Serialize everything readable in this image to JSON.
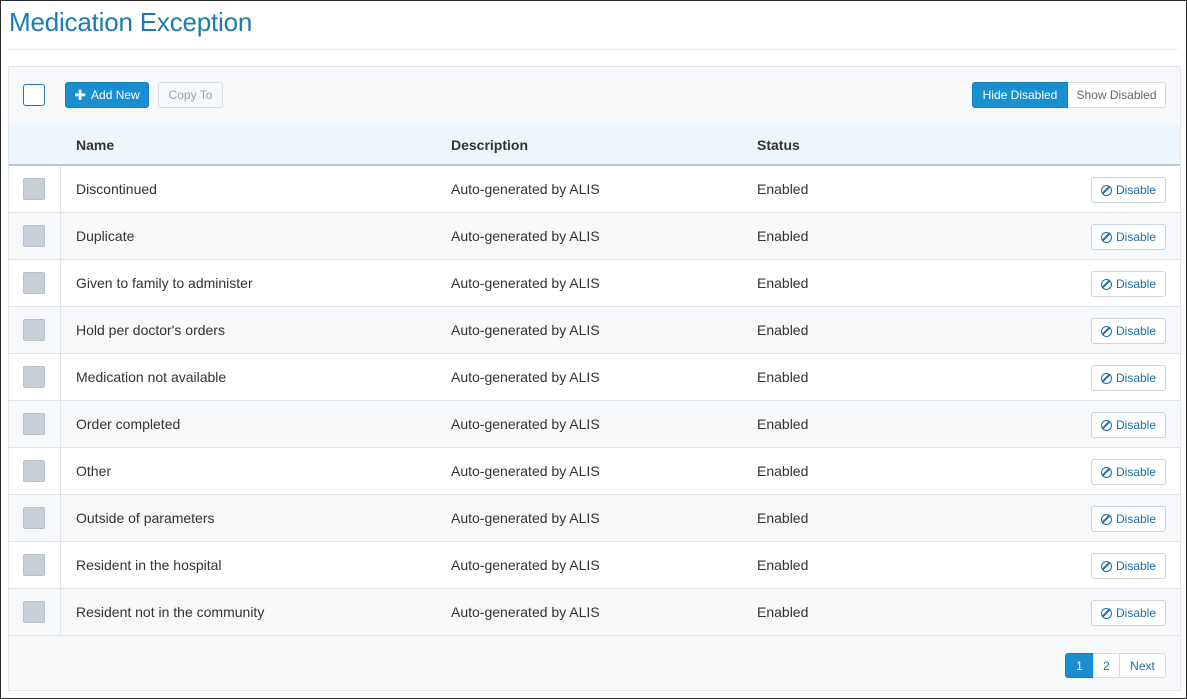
{
  "page": {
    "title": "Medication Exception"
  },
  "toolbar": {
    "add_label": "Add New",
    "copy_label": "Copy To",
    "hide_disabled_label": "Hide Disabled",
    "show_disabled_label": "Show Disabled"
  },
  "table": {
    "headers": {
      "name": "Name",
      "description": "Description",
      "status": "Status"
    },
    "action_label": "Disable",
    "rows": [
      {
        "name": "Discontinued",
        "description": "Auto-generated by ALIS",
        "status": "Enabled"
      },
      {
        "name": "Duplicate",
        "description": "Auto-generated by ALIS",
        "status": "Enabled"
      },
      {
        "name": "Given to family to administer",
        "description": "Auto-generated by ALIS",
        "status": "Enabled"
      },
      {
        "name": "Hold per doctor's orders",
        "description": "Auto-generated by ALIS",
        "status": "Enabled"
      },
      {
        "name": "Medication not available",
        "description": "Auto-generated by ALIS",
        "status": "Enabled"
      },
      {
        "name": "Order completed",
        "description": "Auto-generated by ALIS",
        "status": "Enabled"
      },
      {
        "name": "Other",
        "description": "Auto-generated by ALIS",
        "status": "Enabled"
      },
      {
        "name": "Outside of parameters",
        "description": "Auto-generated by ALIS",
        "status": "Enabled"
      },
      {
        "name": "Resident in the hospital",
        "description": "Auto-generated by ALIS",
        "status": "Enabled"
      },
      {
        "name": "Resident not in the community",
        "description": "Auto-generated by ALIS",
        "status": "Enabled"
      }
    ]
  },
  "pagination": {
    "pages": [
      "1",
      "2"
    ],
    "current": "1",
    "next_label": "Next"
  },
  "colors": {
    "accent": "#1a8fd0",
    "title": "#1b7cb4"
  },
  "icons": {
    "add": "plus-icon",
    "disable": "ban-icon"
  }
}
